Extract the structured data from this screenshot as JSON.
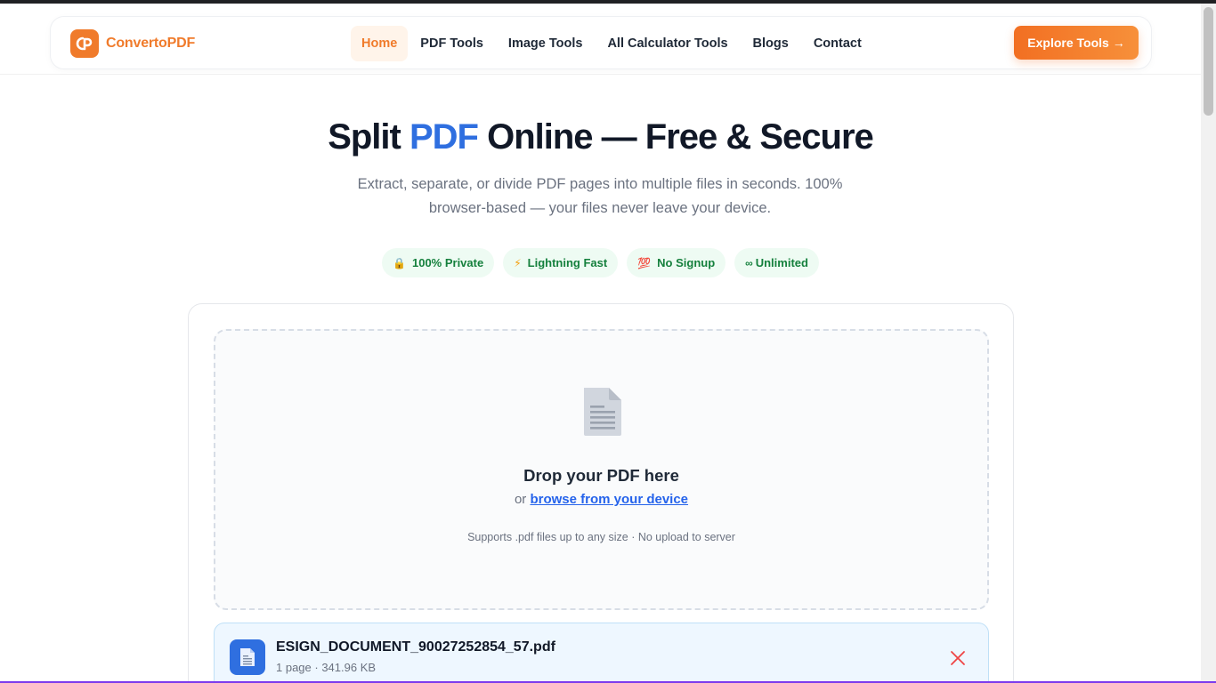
{
  "brand": {
    "name": "ConvertoPDF",
    "logo_icon": "cp-logo-icon",
    "color": "#f07b2b"
  },
  "nav": {
    "links": [
      {
        "label": "Home",
        "active": true
      },
      {
        "label": "PDF Tools",
        "active": false
      },
      {
        "label": "Image Tools",
        "active": false
      },
      {
        "label": "All Calculator Tools",
        "active": false
      },
      {
        "label": "Blogs",
        "active": false
      },
      {
        "label": "Contact",
        "active": false
      }
    ],
    "cta_label": "Explore Tools →"
  },
  "hero": {
    "title_pre": "Split ",
    "title_accent": "PDF",
    "title_post": " Online — Free & Secure",
    "subtitle": "Extract, separate, or divide PDF pages into multiple files in seconds. 100% browser-based — your files never leave your device.",
    "accent_color": "#2f6fe0"
  },
  "badges": [
    {
      "icon": "🔒",
      "icon_name": "lock-icon",
      "label": "100% Private"
    },
    {
      "icon": "⚡",
      "icon_name": "lightning-icon",
      "label": "Lightning Fast"
    },
    {
      "icon": "💯",
      "icon_name": "hundred-icon",
      "label": "No Signup"
    },
    {
      "icon": "∞",
      "icon_name": "infinity-icon",
      "label": "Unlimited"
    }
  ],
  "dropzone": {
    "icon": "document-icon",
    "title": "Drop your PDF here",
    "or_text": "or ",
    "browse_label": "browse from your device",
    "note": "Supports .pdf files up to any size · No upload to server"
  },
  "file": {
    "name": "ESIGN_DOCUMENT_90027252854_57.pdf",
    "meta": "1 page · 341.96 KB",
    "icon": "file-icon",
    "remove_icon": "close-icon"
  }
}
